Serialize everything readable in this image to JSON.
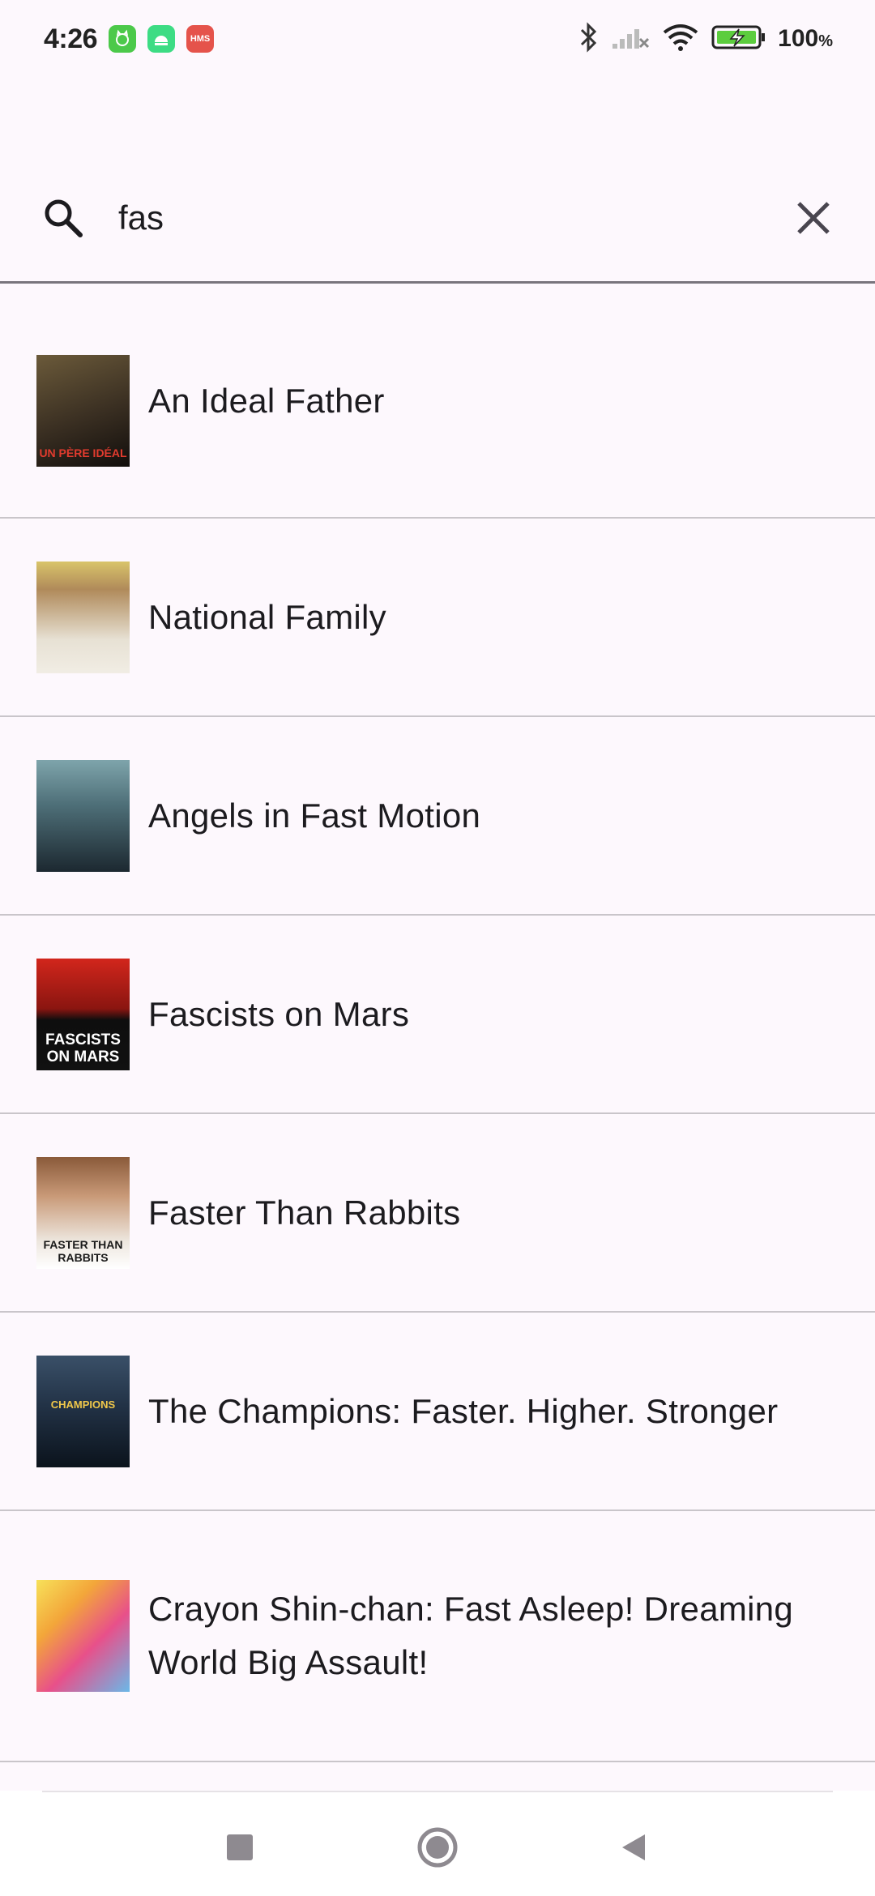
{
  "status_bar": {
    "time": "4:26",
    "app_icons": [
      "cat-app-icon",
      "android-icon",
      "hms-icon"
    ],
    "hms_label": "HMS",
    "battery_percent": "100",
    "battery_unit": "%"
  },
  "search": {
    "query": "fas",
    "placeholder": "Search"
  },
  "results": [
    {
      "title": "An Ideal Father",
      "poster_text": "UN PÈRE IDÉAL",
      "colors": [
        "#5a4a2e",
        "#1a1512"
      ]
    },
    {
      "title": "National Family",
      "poster_text": "",
      "colors": [
        "#c9b08a",
        "#e9e3d6"
      ]
    },
    {
      "title": "Angels in Fast Motion",
      "poster_text": "",
      "colors": [
        "#6b8c94",
        "#1f2b33"
      ]
    },
    {
      "title": "Fascists on Mars",
      "poster_text": "FASCISTS ON MARS",
      "colors": [
        "#c4201a",
        "#111111"
      ]
    },
    {
      "title": "Faster Than Rabbits",
      "poster_text": "FASTER THAN RABBITS",
      "colors": [
        "#e8e2da",
        "#8a5a3a"
      ]
    },
    {
      "title": "The Champions: Faster. Higher. Stronger",
      "poster_text": "CHAMPIONS",
      "colors": [
        "#2a3c52",
        "#0d1620"
      ]
    },
    {
      "title": "Crayon Shin-chan: Fast Asleep! Dreaming World Big Assault!",
      "poster_text": "",
      "colors": [
        "#f5d64a",
        "#e84a8a"
      ]
    }
  ],
  "colors": {
    "background": "#fdf8fd",
    "divider": "#c9c5ca",
    "text": "#1c1b1f"
  }
}
